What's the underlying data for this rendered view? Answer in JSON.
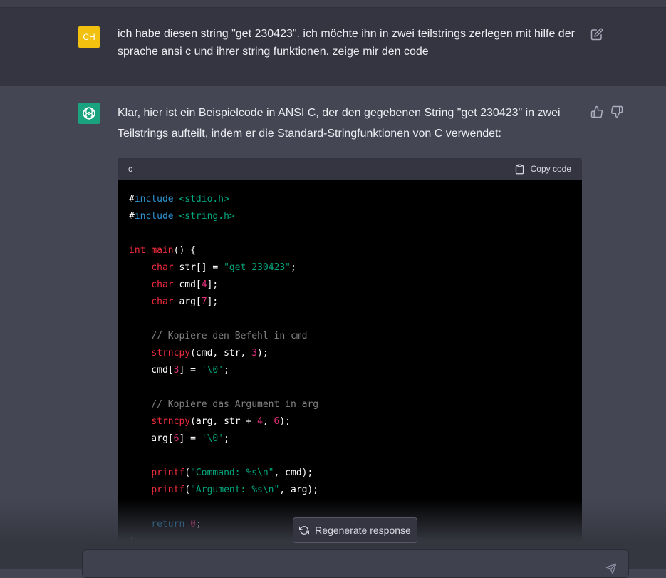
{
  "user_message": {
    "avatar_initials": "CH",
    "text": "ich habe diesen string \"get 230423\". ich möchte ihn in zwei teilstrings zerlegen mit hilfe der sprache ansi c und ihrer string funktionen. zeige mir den code"
  },
  "assistant_message": {
    "text": "Klar, hier ist ein Beispielcode in ANSI C, der den gegebenen String \"get 230423\" in zwei Teilstrings aufteilt, indem er die Standard-Stringfunktionen von C verwendet:",
    "code_block": {
      "language": "c",
      "copy_label": "Copy code",
      "lines": [
        [
          {
            "t": "#",
            "c": ""
          },
          {
            "t": "include",
            "c": "kw-pre"
          },
          {
            "t": " ",
            "c": ""
          },
          {
            "t": "<stdio.h>",
            "c": "str"
          }
        ],
        [
          {
            "t": "#",
            "c": ""
          },
          {
            "t": "include",
            "c": "kw-pre"
          },
          {
            "t": " ",
            "c": ""
          },
          {
            "t": "<string.h>",
            "c": "str"
          }
        ],
        [],
        [
          {
            "t": "int",
            "c": "type"
          },
          {
            "t": " ",
            "c": ""
          },
          {
            "t": "main",
            "c": "fn"
          },
          {
            "t": "() {",
            "c": ""
          }
        ],
        [
          {
            "t": "    ",
            "c": ""
          },
          {
            "t": "char",
            "c": "type"
          },
          {
            "t": " str[] = ",
            "c": ""
          },
          {
            "t": "\"get 230423\"",
            "c": "str"
          },
          {
            "t": ";",
            "c": ""
          }
        ],
        [
          {
            "t": "    ",
            "c": ""
          },
          {
            "t": "char",
            "c": "type"
          },
          {
            "t": " cmd[",
            "c": ""
          },
          {
            "t": "4",
            "c": "num"
          },
          {
            "t": "];",
            "c": ""
          }
        ],
        [
          {
            "t": "    ",
            "c": ""
          },
          {
            "t": "char",
            "c": "type"
          },
          {
            "t": " arg[",
            "c": ""
          },
          {
            "t": "7",
            "c": "num"
          },
          {
            "t": "];",
            "c": ""
          }
        ],
        [],
        [
          {
            "t": "    ",
            "c": ""
          },
          {
            "t": "// Kopiere den Befehl in cmd",
            "c": "com"
          }
        ],
        [
          {
            "t": "    ",
            "c": ""
          },
          {
            "t": "strncpy",
            "c": "fn"
          },
          {
            "t": "(cmd, str, ",
            "c": ""
          },
          {
            "t": "3",
            "c": "num"
          },
          {
            "t": ");",
            "c": ""
          }
        ],
        [
          {
            "t": "    cmd[",
            "c": ""
          },
          {
            "t": "3",
            "c": "num"
          },
          {
            "t": "] = ",
            "c": ""
          },
          {
            "t": "'\\0'",
            "c": "str"
          },
          {
            "t": ";",
            "c": ""
          }
        ],
        [],
        [
          {
            "t": "    ",
            "c": ""
          },
          {
            "t": "// Kopiere das Argument in arg",
            "c": "com"
          }
        ],
        [
          {
            "t": "    ",
            "c": ""
          },
          {
            "t": "strncpy",
            "c": "fn"
          },
          {
            "t": "(arg, str + ",
            "c": ""
          },
          {
            "t": "4",
            "c": "num"
          },
          {
            "t": ", ",
            "c": ""
          },
          {
            "t": "6",
            "c": "num"
          },
          {
            "t": ");",
            "c": ""
          }
        ],
        [
          {
            "t": "    arg[",
            "c": ""
          },
          {
            "t": "6",
            "c": "num"
          },
          {
            "t": "] = ",
            "c": ""
          },
          {
            "t": "'\\0'",
            "c": "str"
          },
          {
            "t": ";",
            "c": ""
          }
        ],
        [],
        [
          {
            "t": "    ",
            "c": ""
          },
          {
            "t": "printf",
            "c": "fn"
          },
          {
            "t": "(",
            "c": ""
          },
          {
            "t": "\"Command: %s\\n\"",
            "c": "str"
          },
          {
            "t": ", cmd);",
            "c": ""
          }
        ],
        [
          {
            "t": "    ",
            "c": ""
          },
          {
            "t": "printf",
            "c": "fn"
          },
          {
            "t": "(",
            "c": ""
          },
          {
            "t": "\"Argument: %s\\n\"",
            "c": "str"
          },
          {
            "t": ", arg);",
            "c": ""
          }
        ],
        [],
        [
          {
            "t": "    ",
            "c": ""
          },
          {
            "t": "return",
            "c": "ret"
          },
          {
            "t": " ",
            "c": ""
          },
          {
            "t": "0",
            "c": "num"
          },
          {
            "t": ";",
            "c": ""
          }
        ],
        [
          {
            "t": "}",
            "c": ""
          }
        ]
      ]
    }
  },
  "regenerate_label": "Regenerate response",
  "input": {
    "value": "",
    "placeholder": ""
  },
  "colors": {
    "user_avatar": "#f2c10f",
    "assistant_avatar": "#19a37f",
    "background_user": "#343541",
    "background_assistant": "#444654"
  },
  "icons": [
    "edit-icon",
    "openai-logo-icon",
    "thumbs-up-icon",
    "thumbs-down-icon",
    "clipboard-icon",
    "refresh-icon",
    "send-icon"
  ]
}
